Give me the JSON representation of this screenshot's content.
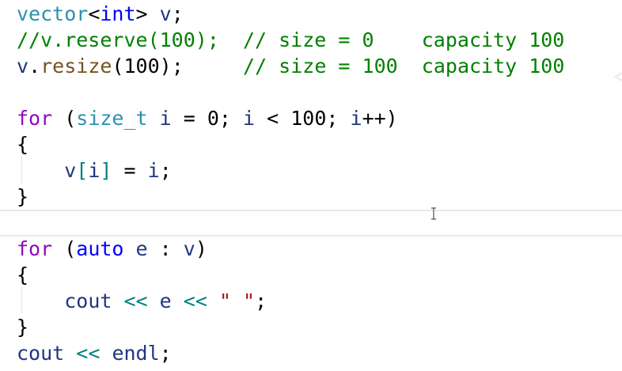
{
  "editor": {
    "lines": [
      {
        "tokens": [
          {
            "t": "vector",
            "c": "ty"
          },
          {
            "t": "<",
            "c": "pl"
          },
          {
            "t": "int",
            "c": "kw"
          },
          {
            "t": ">",
            "c": "pl"
          },
          {
            "t": " v",
            "c": "var"
          },
          {
            "t": ";",
            "c": "pl"
          }
        ]
      },
      {
        "tokens": [
          {
            "t": "//v.reserve(100);  // size = 0    capacity 100",
            "c": "cm"
          }
        ]
      },
      {
        "tokens": [
          {
            "t": "v",
            "c": "var"
          },
          {
            "t": ".",
            "c": "pl"
          },
          {
            "t": "resize",
            "c": "fn"
          },
          {
            "t": "(",
            "c": "pl"
          },
          {
            "t": "100",
            "c": "pl"
          },
          {
            "t": ");     ",
            "c": "pl"
          },
          {
            "t": "// size = 100  capacity 100",
            "c": "cm"
          }
        ]
      },
      {
        "tokens": []
      },
      {
        "tokens": [
          {
            "t": "for",
            "c": "kw2"
          },
          {
            "t": " (",
            "c": "pl"
          },
          {
            "t": "size_t",
            "c": "ty"
          },
          {
            "t": " i",
            "c": "var"
          },
          {
            "t": " = ",
            "c": "pl"
          },
          {
            "t": "0",
            "c": "pl"
          },
          {
            "t": "; ",
            "c": "pl"
          },
          {
            "t": "i",
            "c": "var"
          },
          {
            "t": " < ",
            "c": "pl"
          },
          {
            "t": "100",
            "c": "pl"
          },
          {
            "t": "; ",
            "c": "pl"
          },
          {
            "t": "i",
            "c": "var"
          },
          {
            "t": "++)",
            "c": "pl"
          }
        ]
      },
      {
        "tokens": [
          {
            "t": "{",
            "c": "pl"
          }
        ]
      },
      {
        "tokens": [
          {
            "t": "    ",
            "c": "pl"
          },
          {
            "t": "v",
            "c": "var"
          },
          {
            "t": "[",
            "c": "op"
          },
          {
            "t": "i",
            "c": "var"
          },
          {
            "t": "]",
            "c": "op"
          },
          {
            "t": " = ",
            "c": "pl"
          },
          {
            "t": "i",
            "c": "var"
          },
          {
            "t": ";",
            "c": "pl"
          }
        ]
      },
      {
        "tokens": [
          {
            "t": "}",
            "c": "pl"
          }
        ]
      },
      {
        "tokens": []
      },
      {
        "tokens": [
          {
            "t": "for",
            "c": "kw2"
          },
          {
            "t": " (",
            "c": "pl"
          },
          {
            "t": "auto",
            "c": "kw"
          },
          {
            "t": " e",
            "c": "var"
          },
          {
            "t": " : ",
            "c": "pl"
          },
          {
            "t": "v",
            "c": "var"
          },
          {
            "t": ")",
            "c": "pl"
          }
        ]
      },
      {
        "tokens": [
          {
            "t": "{",
            "c": "pl"
          }
        ]
      },
      {
        "tokens": [
          {
            "t": "    ",
            "c": "pl"
          },
          {
            "t": "cout",
            "c": "var"
          },
          {
            "t": " << ",
            "c": "op"
          },
          {
            "t": "e",
            "c": "var"
          },
          {
            "t": " << ",
            "c": "op"
          },
          {
            "t": "\" \"",
            "c": "str"
          },
          {
            "t": ";",
            "c": "pl"
          }
        ]
      },
      {
        "tokens": [
          {
            "t": "}",
            "c": "pl"
          }
        ]
      },
      {
        "tokens": [
          {
            "t": "cout",
            "c": "var"
          },
          {
            "t": " << ",
            "c": "op"
          },
          {
            "t": "endl",
            "c": "var"
          },
          {
            "t": ";",
            "c": "pl"
          }
        ]
      }
    ]
  },
  "icons": {
    "cursor": "text-cursor-icon",
    "hint": "lightbulb-icon"
  },
  "colors": {
    "keyword": "#0000ff",
    "control_keyword": "#8f08c4",
    "type": "#2b91af",
    "variable": "#1f377f",
    "comment": "#008000",
    "string": "#a31515",
    "operator": "#008080",
    "current_line_border": "#e8e8e8"
  }
}
